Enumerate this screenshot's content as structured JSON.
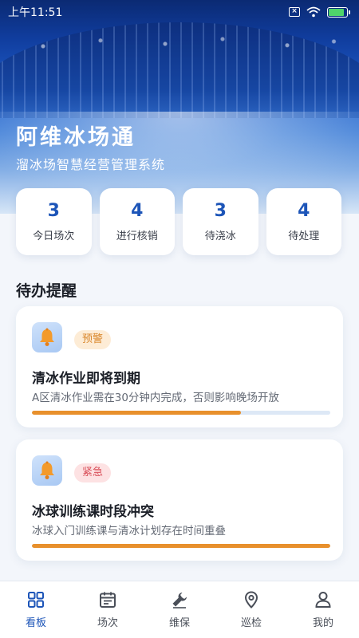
{
  "status_bar": {
    "time": "上午11:51",
    "battery_level": 0.85
  },
  "header": {
    "title": "阿维冰场通",
    "subtitle": "溜冰场智慧经营管理系统"
  },
  "stats": [
    {
      "value": "3",
      "label": "今日场次"
    },
    {
      "value": "4",
      "label": "进行核销"
    },
    {
      "value": "3",
      "label": "待浇冰"
    },
    {
      "value": "4",
      "label": "待处理"
    }
  ],
  "todo": {
    "section_title": "待办提醒",
    "items": [
      {
        "badge": "预警",
        "badge_type": "warning",
        "title": "清冰作业即将到期",
        "description": "A区清冰作业需在30分钟内完成，否则影响晚场开放",
        "progress": 0.7,
        "icon": "bell-icon"
      },
      {
        "badge": "紧急",
        "badge_type": "urgent",
        "title": "冰球训练课时段冲突",
        "description": "冰球入门训练课与清冰计划存在时间重叠",
        "progress": 1.0,
        "icon": "bell-icon"
      }
    ]
  },
  "tabs": [
    {
      "label": "看板",
      "icon": "dashboard-grid-icon",
      "active": true
    },
    {
      "label": "场次",
      "icon": "calendar-icon",
      "active": false
    },
    {
      "label": "维保",
      "icon": "wrench-icon",
      "active": false
    },
    {
      "label": "巡检",
      "icon": "location-pin-icon",
      "active": false
    },
    {
      "label": "我的",
      "icon": "user-icon",
      "active": false
    }
  ],
  "colors": {
    "accent": "#1d55b8",
    "warning_badge_text": "#d9862a",
    "urgent_badge_text": "#d9515b",
    "progress_fill": "#e8902c",
    "progress_track": "#dde8f6"
  }
}
